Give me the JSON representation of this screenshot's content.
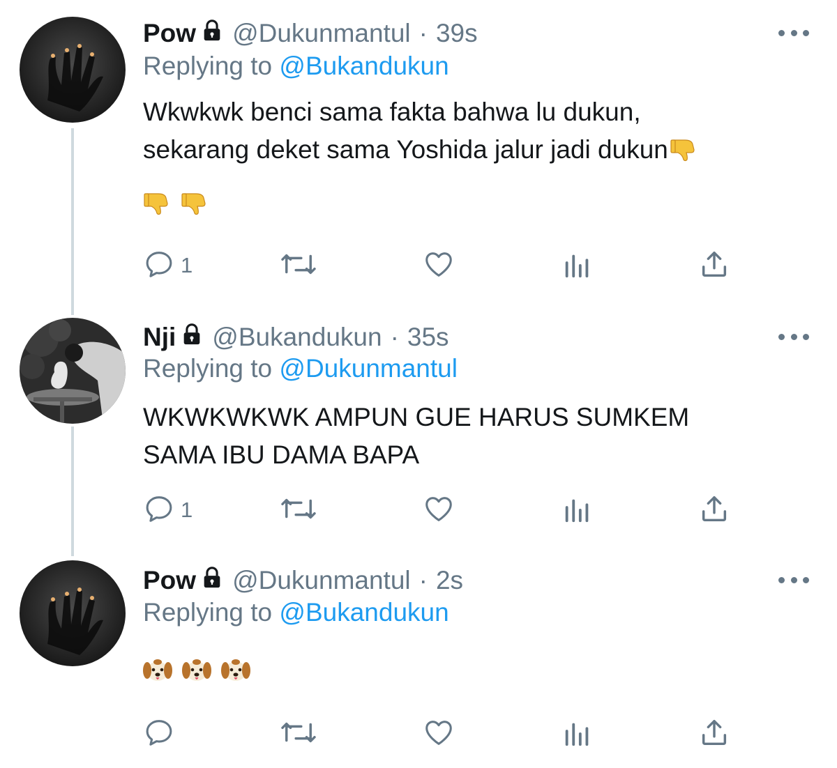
{
  "tweets": [
    {
      "name": "Pow",
      "handle": "@Dukunmantul",
      "dot": "·",
      "time": "39s",
      "replying_prefix": "Replying to",
      "replying_to": "@Bukandukun",
      "text_line1": "Wkwkwk benci sama fakta bahwa lu dukun,",
      "text_line2": "sekarang deket sama Yoshida jalur jadi dukun",
      "emojis": [
        "thumbs-down",
        "thumbs-down",
        "thumbs-down"
      ],
      "reply_count": "1"
    },
    {
      "name": "Nji",
      "handle": "@Bukandukun",
      "dot": "·",
      "time": "35s",
      "replying_prefix": "Replying to",
      "replying_to": "@Dukunmantul",
      "text_line1": "WKWKWKWK AMPUN GUE HARUS SUMKEM",
      "text_line2": "SAMA IBU DAMA BAPA",
      "reply_count": "1"
    },
    {
      "name": "Pow",
      "handle": "@Dukunmantul",
      "dot": "·",
      "time": "2s",
      "replying_prefix": "Replying to",
      "replying_to": "@Bukandukun",
      "emojis": [
        "dog-face",
        "dog-face",
        "dog-face"
      ],
      "reply_count": ""
    }
  ],
  "icons": {
    "reply": "reply-icon",
    "retweet": "retweet-icon",
    "like": "heart-icon",
    "analytics": "analytics-icon",
    "share": "share-icon",
    "more": "more-icon",
    "protected": "lock-icon"
  },
  "colors": {
    "text": "#14171a",
    "secondary": "#657786",
    "link": "#1d9bf0",
    "thread_line": "#cfd9de",
    "thumbs": "#f5c33b"
  }
}
